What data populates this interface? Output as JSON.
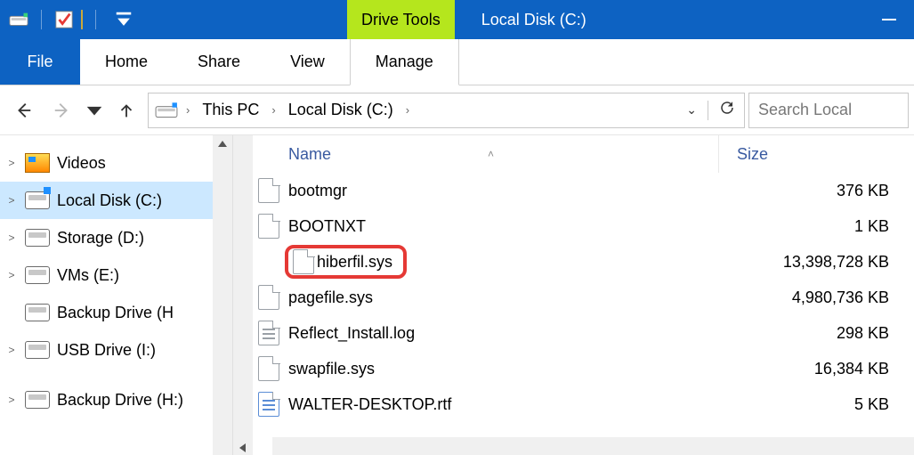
{
  "colors": {
    "accent": "#0d62c2",
    "drive_tools_bg": "#b5e61d",
    "highlight": "#e53935",
    "selection": "#cce8ff"
  },
  "titlebar": {
    "qat_icons": [
      "drive-icon",
      "divider",
      "checkbox-icon",
      "folder-icon",
      "divider",
      "down-chevron-icon"
    ],
    "context_tab": "Drive Tools",
    "window_title": "Local Disk (C:)"
  },
  "ribbon": {
    "file": "File",
    "tabs": [
      "Home",
      "Share",
      "View"
    ],
    "context_tab": "Manage"
  },
  "nav": {
    "back_enabled": true,
    "forward_enabled": false,
    "breadcrumbs": [
      "This PC",
      "Local Disk (C:)"
    ],
    "search_placeholder": "Search Local"
  },
  "tree": {
    "items": [
      {
        "icon": "videos",
        "label": "Videos",
        "selected": false
      },
      {
        "icon": "drive-c",
        "label": "Local Disk (C:)",
        "selected": true
      },
      {
        "icon": "drive",
        "label": "Storage (D:)",
        "selected": false
      },
      {
        "icon": "drive",
        "label": "VMs (E:)",
        "selected": false
      },
      {
        "icon": "drive",
        "label": "Backup Drive (H",
        "selected": false,
        "no_expander": true
      },
      {
        "icon": "drive",
        "label": "USB Drive (I:)",
        "selected": false
      },
      {
        "gap": true
      },
      {
        "icon": "drive",
        "label": "Backup Drive (H:)",
        "selected": false
      }
    ]
  },
  "list": {
    "columns": {
      "name": "Name",
      "size": "Size"
    },
    "rows": [
      {
        "icon": "file",
        "name": "bootmgr",
        "size": "376 KB",
        "highlighted": false
      },
      {
        "icon": "file",
        "name": "BOOTNXT",
        "size": "1 KB",
        "highlighted": false
      },
      {
        "icon": "file",
        "name": "hiberfil.sys",
        "size": "13,398,728 KB",
        "highlighted": true
      },
      {
        "icon": "file",
        "name": "pagefile.sys",
        "size": "4,980,736 KB",
        "highlighted": false
      },
      {
        "icon": "log",
        "name": "Reflect_Install.log",
        "size": "298 KB",
        "highlighted": false
      },
      {
        "icon": "file",
        "name": "swapfile.sys",
        "size": "16,384 KB",
        "highlighted": false
      },
      {
        "icon": "rtf",
        "name": "WALTER-DESKTOP.rtf",
        "size": "5 KB",
        "highlighted": false
      }
    ]
  }
}
